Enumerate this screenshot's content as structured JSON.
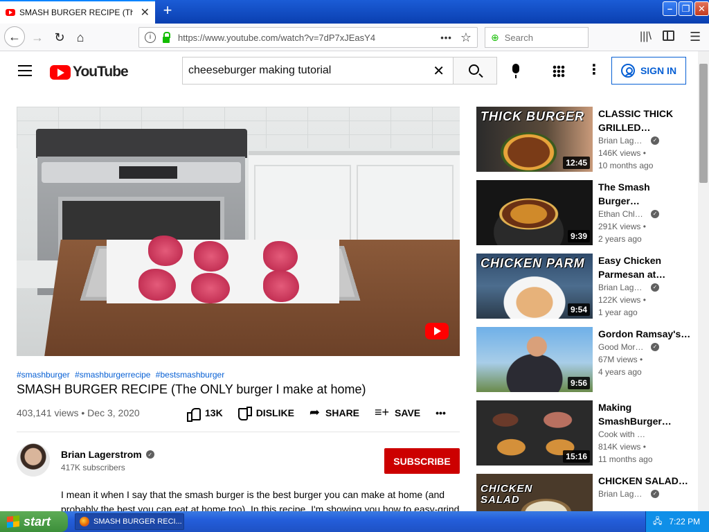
{
  "browser": {
    "tab_title": "SMASH BURGER RECIPE (The ONLY burger I make at home)",
    "new_tab": "+",
    "url": "https://www.youtube.com/watch?v=7dP7xJEasY4",
    "search_placeholder": "Search"
  },
  "youtube": {
    "logo_text": "YouTube",
    "search_query": "cheeseburger making tutorial",
    "sign_in": "SIGN IN"
  },
  "video": {
    "hashtags": [
      "#smashburger",
      "#smashburgerrecipe",
      "#bestsmashburger"
    ],
    "title": "SMASH BURGER RECIPE (The ONLY burger I make at home)",
    "stats": "403,141 views • Dec 3, 2020",
    "like_count": "13K",
    "dislike_label": "DISLIKE",
    "share_label": "SHARE",
    "save_label": "SAVE",
    "more_label": "•••"
  },
  "channel": {
    "name": "Brian Lagerstrom",
    "subscribers": "417K subscribers",
    "subscribe_label": "SUBSCRIBE",
    "description": "I mean it when I say that the smash burger is the best burger you can make at home (and probably the best you can eat at home too). In this recipe, I'm showing you how to easy-grind"
  },
  "recommendations": [
    {
      "title": "CLASSIC THICK GRILLED…",
      "channel": "Brian Lager…",
      "verified": true,
      "views": "146K views •",
      "age": "10 months ago",
      "duration": "12:45",
      "thumb_text": "THICK BURGER"
    },
    {
      "title": "The Smash Burger…",
      "channel": "Ethan Chleb…",
      "verified": true,
      "views": "291K views •",
      "age": "2 years ago",
      "duration": "9:39",
      "thumb_text": ""
    },
    {
      "title": "Easy Chicken Parmesan at…",
      "channel": "Brian Lager…",
      "verified": true,
      "views": "122K views •",
      "age": "1 year ago",
      "duration": "9:54",
      "thumb_text": "CHICKEN PARM"
    },
    {
      "title": "Gordon Ramsay's…",
      "channel": "Good Morni…",
      "verified": true,
      "views": "67M views •",
      "age": "4 years ago",
      "duration": "9:56",
      "thumb_text": ""
    },
    {
      "title": "Making SmashBurger…",
      "channel": "Cook with Ron",
      "verified": false,
      "views": "814K views •",
      "age": "11 months ago",
      "duration": "15:16",
      "thumb_text": ""
    },
    {
      "title": "CHICKEN SALAD…",
      "channel": "Brian Lager…",
      "verified": true,
      "views": "",
      "age": "",
      "duration": "",
      "thumb_text": "CHICKEN SALAD"
    }
  ],
  "taskbar": {
    "start": "start",
    "task": "SMASH BURGER RECI...",
    "clock": "7:22 PM"
  }
}
